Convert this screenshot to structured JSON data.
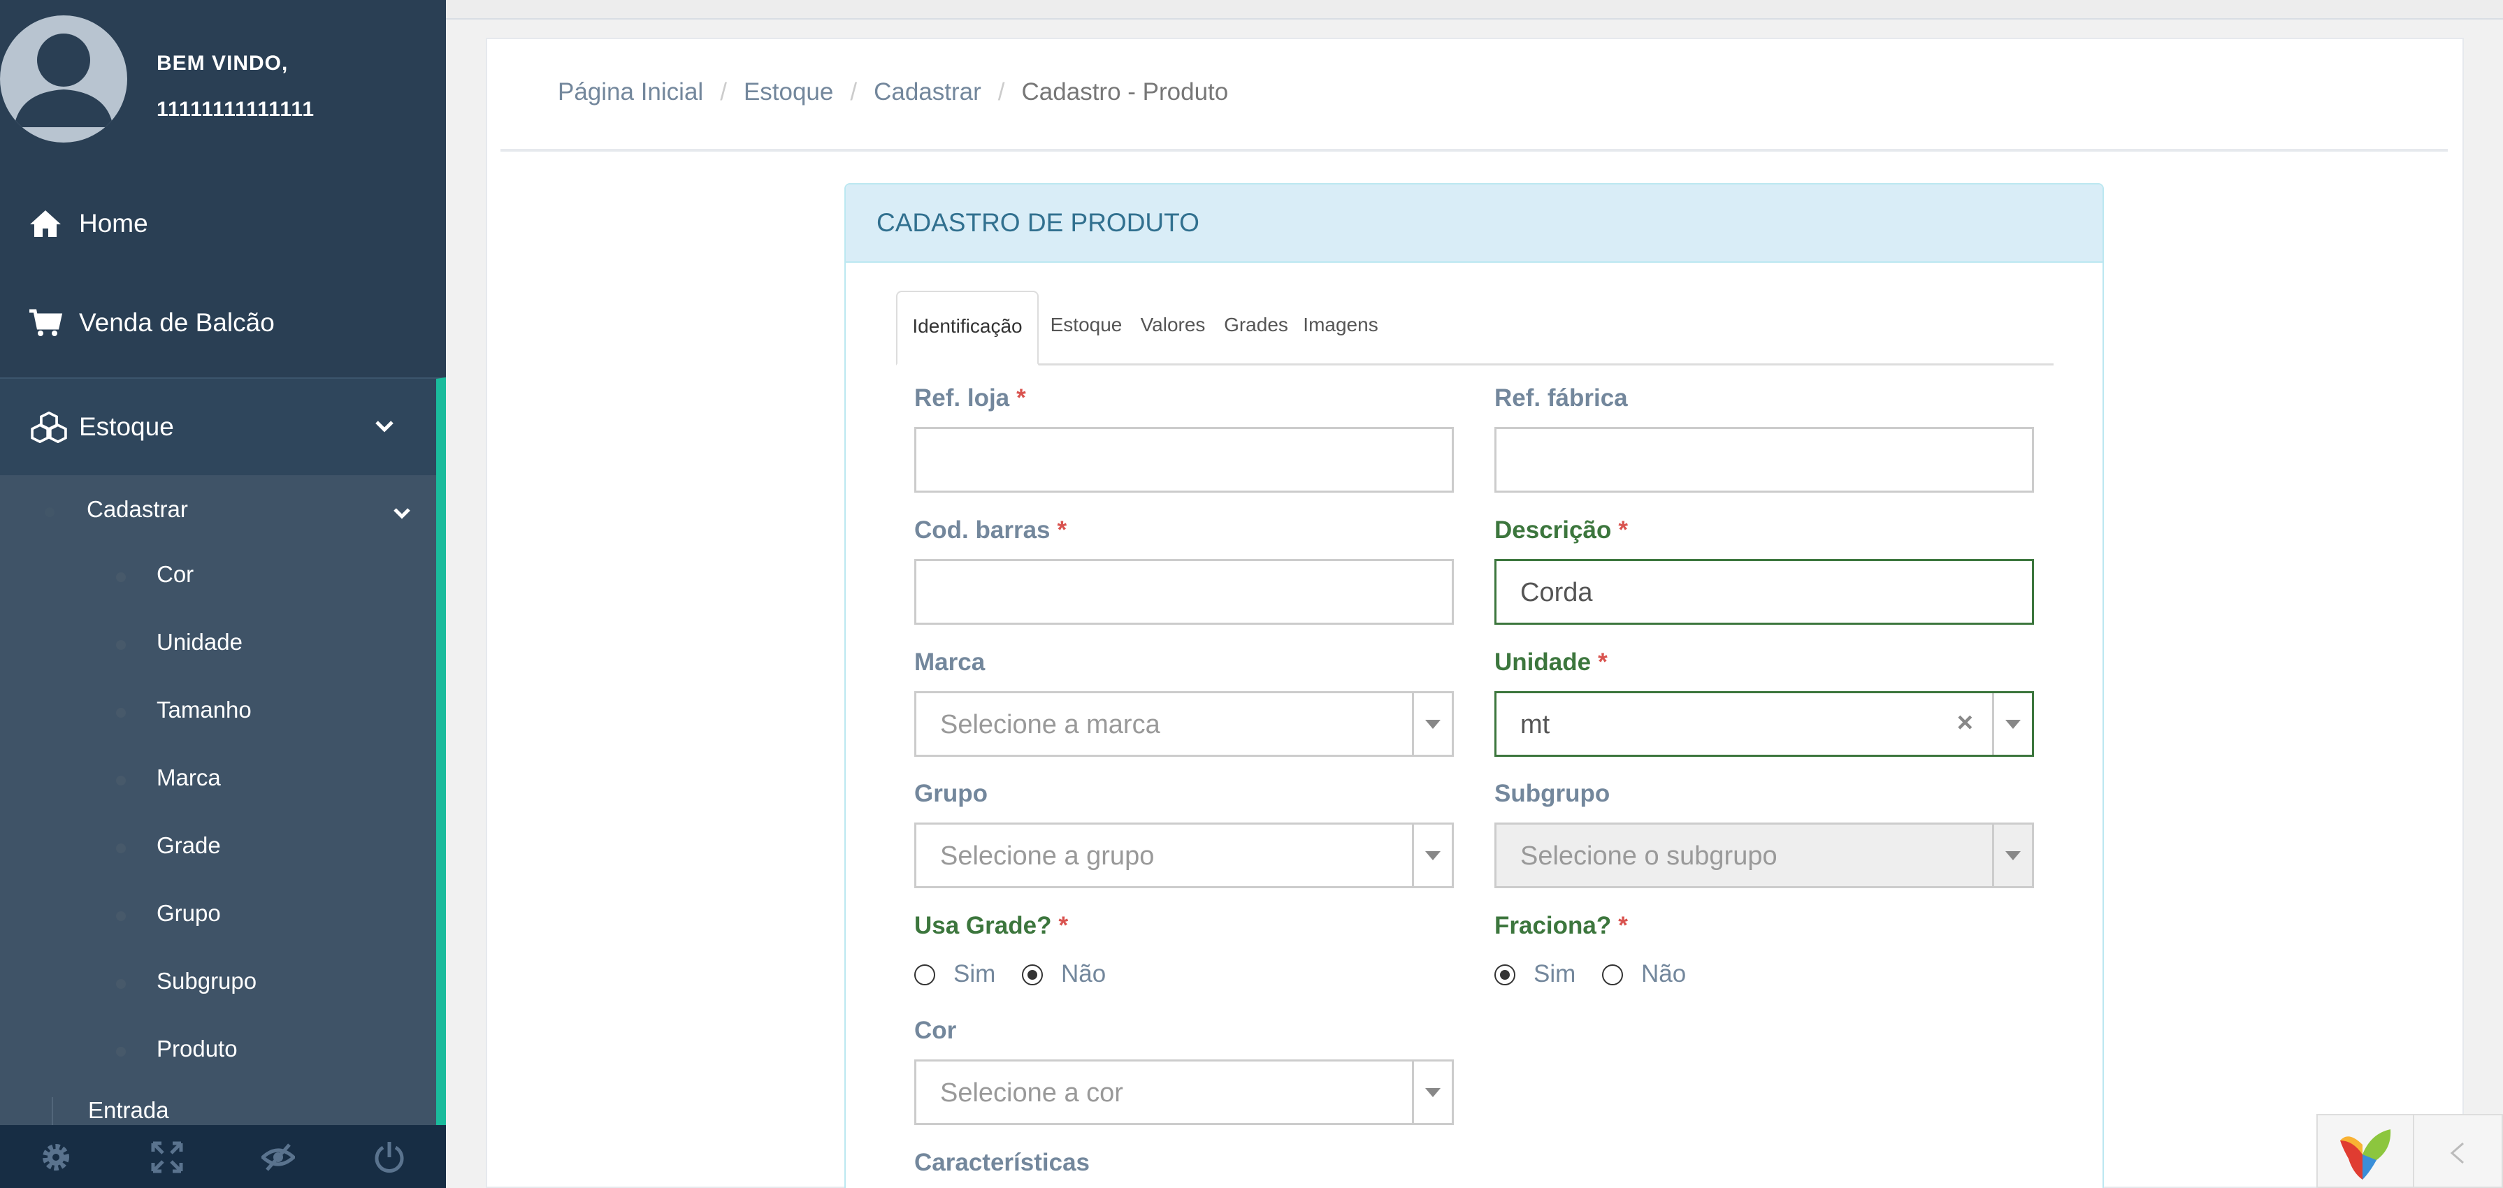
{
  "sidebar": {
    "welcome": "BEM VINDO,",
    "user": "11111111111111",
    "nav": {
      "home": "Home",
      "venda": "Venda de Balcão",
      "estoque": "Estoque"
    },
    "submenu": {
      "cadastrar": "Cadastrar",
      "items": [
        "Cor",
        "Unidade",
        "Tamanho",
        "Marca",
        "Grade",
        "Grupo",
        "Subgrupo",
        "Produto"
      ],
      "entrada": "Entrada"
    },
    "footer_icons": [
      "gear-icon",
      "fullscreen-icon",
      "eye-slash-icon",
      "power-icon"
    ]
  },
  "breadcrumb": [
    "Página Inicial",
    "Estoque",
    "Cadastrar",
    "Cadastro - Produto"
  ],
  "panel": {
    "title": "CADASTRO DE PRODUTO",
    "tabs": [
      "Identificação",
      "Estoque",
      "Valores",
      "Grades",
      "Imagens"
    ],
    "active_tab": "Identificação"
  },
  "form": {
    "ref_loja": {
      "label": "Ref. loja",
      "required": "*",
      "value": ""
    },
    "ref_fabrica": {
      "label": "Ref. fábrica",
      "value": ""
    },
    "cod_barras": {
      "label": "Cod. barras",
      "required": "*",
      "value": ""
    },
    "descricao": {
      "label": "Descrição",
      "required": "*",
      "value": "Corda"
    },
    "marca": {
      "label": "Marca",
      "placeholder": "Selecione a marca"
    },
    "unidade": {
      "label": "Unidade",
      "required": "*",
      "value": "mt",
      "clear": "×"
    },
    "grupo": {
      "label": "Grupo",
      "placeholder": "Selecione a grupo"
    },
    "subgrupo": {
      "label": "Subgrupo",
      "placeholder": "Selecione o subgrupo"
    },
    "usa_grade": {
      "label": "Usa Grade?",
      "required": "*",
      "options": [
        "Sim",
        "Não"
      ],
      "selected": "Não"
    },
    "fraciona": {
      "label": "Fraciona?",
      "required": "*",
      "options": [
        "Sim",
        "Não"
      ],
      "selected": "Sim"
    },
    "cor": {
      "label": "Cor",
      "placeholder": "Selecione a cor"
    },
    "caracteristicas": {
      "label": "Características"
    }
  },
  "colors": {
    "sidebar_bg": "#2a3f54",
    "accent": "#1abb9c",
    "panel_head_bg": "#d9edf7",
    "panel_title": "#31708f",
    "valid_green": "#3c763d",
    "required_red": "#d9534f"
  }
}
